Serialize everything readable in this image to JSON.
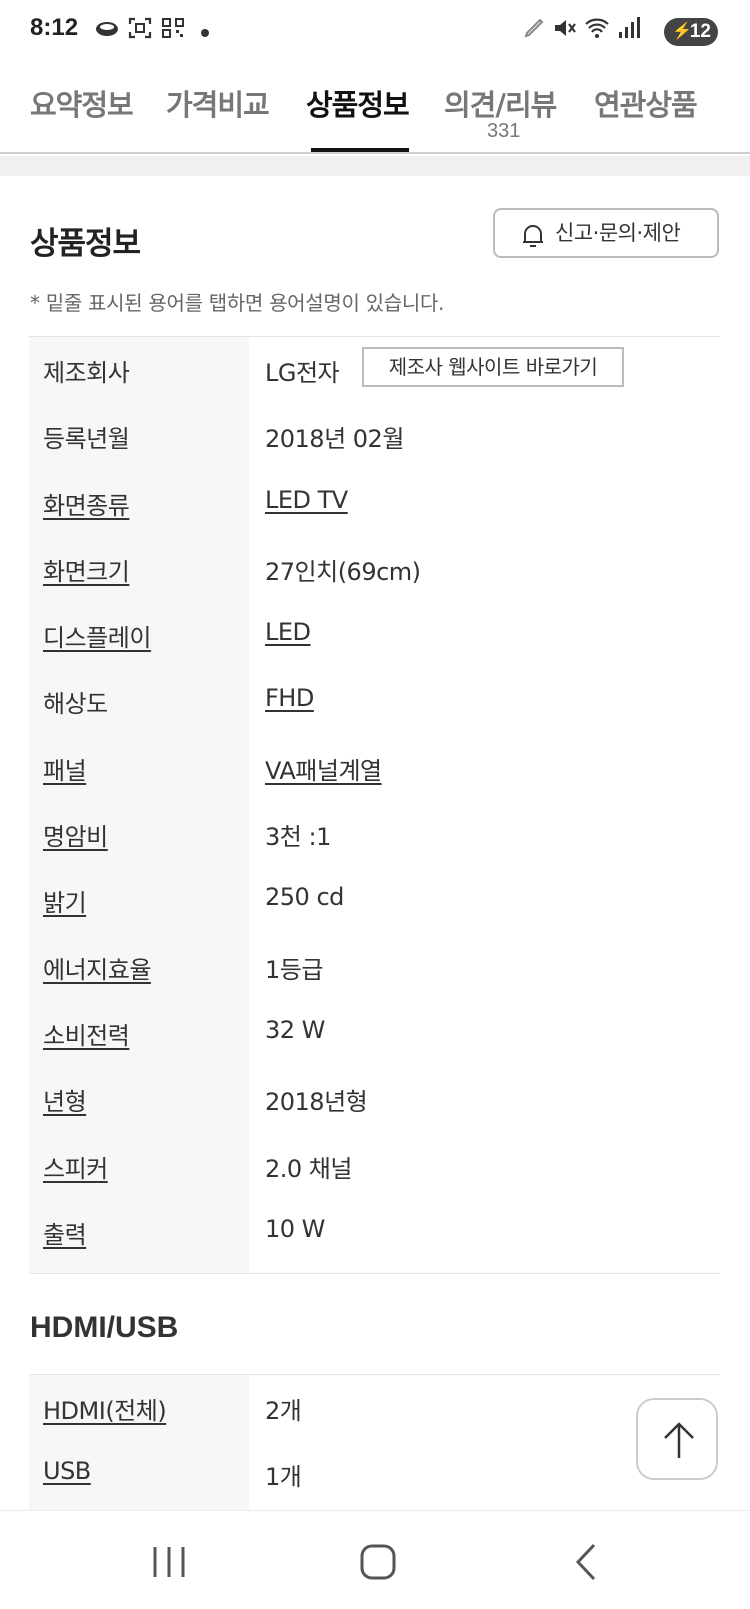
{
  "status_bar": {
    "time": "8:12",
    "battery_level": "12",
    "icons": [
      "cloud-icon",
      "screenshot-icon",
      "qr-icon",
      "notification-dot",
      "edit-icon",
      "mute-icon",
      "wifi-icon",
      "signal-icon",
      "battery-icon"
    ]
  },
  "tabs": [
    {
      "label": "요약정보",
      "active": false
    },
    {
      "label": "가격비교",
      "active": false
    },
    {
      "label": "상품정보",
      "active": true
    },
    {
      "label": "의견/리뷰",
      "count": "331",
      "active": false
    },
    {
      "label": "연관상품",
      "active": false
    }
  ],
  "section": {
    "title": "상품정보",
    "report_button": "신고·문의·제안",
    "note": "* 밑줄 표시된 용어를 탭하면 용어설명이 있습니다."
  },
  "specs": [
    {
      "label": "제조회사",
      "value": "LG전자",
      "button": "제조사 웹사이트 바로가기"
    },
    {
      "label": "등록년월",
      "value": "2018년 02월"
    },
    {
      "label": "화면종류",
      "value": "LED TV"
    },
    {
      "label": "화면크기",
      "value": "27인치(69cm)"
    },
    {
      "label": "디스플레이",
      "value": "LED"
    },
    {
      "label": "해상도",
      "value": "FHD"
    },
    {
      "label": "패널",
      "value": "VA패널계열"
    },
    {
      "label": "명암비",
      "value": "3천 :1"
    },
    {
      "label": "밝기",
      "value": "250 cd"
    },
    {
      "label": "에너지효율",
      "value": "1등급"
    },
    {
      "label": "소비전력",
      "value": "32 W"
    },
    {
      "label": "년형",
      "value": "2018년형"
    },
    {
      "label": "스피커",
      "value": "2.0 채널"
    },
    {
      "label": "출력",
      "value": "10 W"
    }
  ],
  "hdmi_section": {
    "title": "HDMI/USB",
    "specs": [
      {
        "label": "HDMI(전체)",
        "value": "2개"
      },
      {
        "label": "USB",
        "value": "1개"
      }
    ]
  },
  "nav": {
    "icons": [
      "recent-apps-icon",
      "home-icon",
      "back-icon"
    ]
  }
}
